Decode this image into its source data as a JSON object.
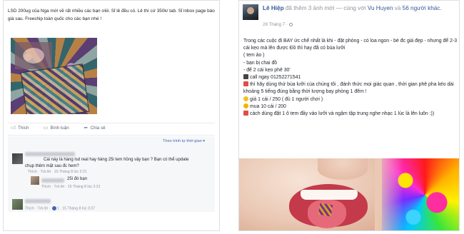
{
  "left_post": {
    "text": "LSD 200ug của Nga mới về rất nhiều các bạn ơiiii. Sỉ lẻ đều có. Lẻ thì cứ 350k/ tab. Sỉ inbox page báo giá sau. Freeship toàn quốc cho các bạn nhé !",
    "actions": {
      "like": "Thích",
      "comment": "Bình luận",
      "share": "Chia sẻ"
    },
    "sort_label": "Theo trình tự thời gian ▾",
    "comments": [
      {
        "text": "Cái này là hàng lsd real hay hàng 25i tem hồng vậy bạn ? Bạn có thể update chụp thêm mặt sau đc hem?",
        "meta": "Thích · Trả lời · 15 Tháng 8 lúc 2:21"
      },
      {
        "text": "25i đó bạn",
        "meta": "Thích · Trả lời · 15 Tháng 8 lúc 2:21"
      },
      {
        "meta_prefix": "Thích · Trả lời · ",
        "like_count": "1",
        "meta_suffix": " · 15 Tháng 8 lúc 3:37"
      }
    ]
  },
  "right_post": {
    "author": "Lê Hiệp",
    "header_mid": " đã thêm 3 ảnh mới — cùng với ",
    "tagged": "Vu Huyen",
    "header_and": " và ",
    "others": "56 người khác.",
    "time": "28 Tháng 7 ·",
    "lines": [
      "Trong các cuộc đi BAY ức chế nhất là khi - đặt phòng - có loa ngon - bè đc giá đẹp - nhưng để 2-3 cái kẹo mà        lên được Đồ thì hay đã có bùa lưỡi",
      "( tem ảo )",
      "- bạn bị chai đồ",
      "- để 2 cái kẹo phê 30'",
      "call ngay 01252271541",
      "thì hãy dùng thử bùa lưỡi của chúng tôi , đánh thức mọi giác quan , thời gian phê pha kéo dài khoảng 5 tiếng đúng bằng thời lượng bay phòng 1 đêm !",
      "giá 1 cái / 250 ( đủ 1 người chơi )",
      "mua 10 cái / 200",
      "cách dùng đặt 1 ô tem đầy vào lưỡi và ngậm tập trung nghe nhạc 1 lúc là lên        luôn :))"
    ]
  },
  "icons": [
    "thumb-up-icon",
    "comment-icon",
    "share-icon",
    "globe-icon",
    "phone-icon",
    "warning-icon",
    "smile-icon"
  ]
}
